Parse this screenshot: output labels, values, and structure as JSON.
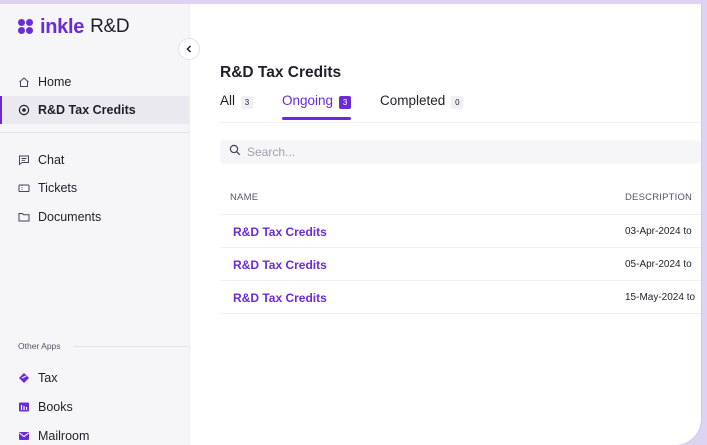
{
  "brand": {
    "name": "inkle",
    "suffix": "R&D"
  },
  "sidebar": {
    "collapse_icon": "chevron-left-icon",
    "main_items": [
      {
        "label": "Home",
        "icon": "home-icon"
      },
      {
        "label": "R&D Tax Credits",
        "icon": "target-icon",
        "active": true
      }
    ],
    "support_items": [
      {
        "label": "Chat",
        "icon": "chat-icon"
      },
      {
        "label": "Tickets",
        "icon": "ticket-icon"
      },
      {
        "label": "Documents",
        "icon": "folder-icon"
      }
    ],
    "other_apps_label": "Other Apps",
    "other_apps": [
      {
        "label": "Tax",
        "icon": "tax-icon",
        "color": "#6b2bd9"
      },
      {
        "label": "Books",
        "icon": "books-icon",
        "color": "#6b2bd9"
      },
      {
        "label": "Mailroom",
        "icon": "mailroom-icon",
        "color": "#6b2bd9"
      }
    ]
  },
  "main": {
    "title": "R&D Tax Credits",
    "tabs": [
      {
        "label": "All",
        "count": "3"
      },
      {
        "label": "Ongoing",
        "count": "3",
        "active": true
      },
      {
        "label": "Completed",
        "count": "0"
      }
    ],
    "search": {
      "placeholder": "Search..."
    },
    "table": {
      "columns": [
        "NAME",
        "DESCRIPTION"
      ],
      "rows": [
        {
          "name": "R&D Tax Credits",
          "description": "03-Apr-2024 to"
        },
        {
          "name": "R&D Tax Credits",
          "description": "05-Apr-2024 to"
        },
        {
          "name": "R&D Tax Credits",
          "description": "15-May-2024 to"
        }
      ]
    }
  },
  "colors": {
    "accent": "#6b2bd9",
    "background": "#ddd3f3",
    "sidebar": "#f6f6f8"
  }
}
